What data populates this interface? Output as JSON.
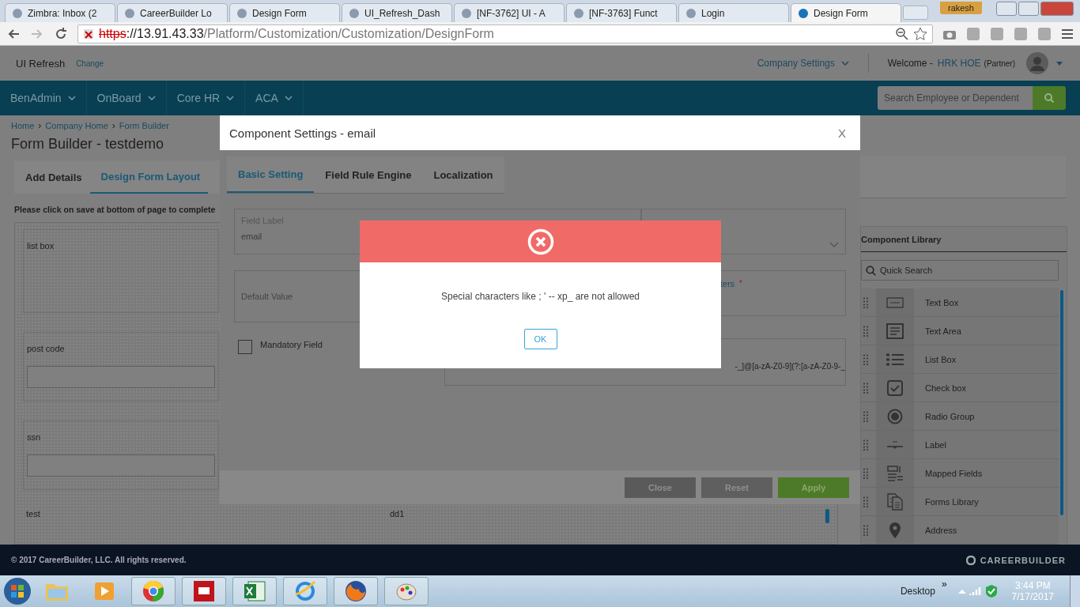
{
  "browser": {
    "tabs": [
      {
        "title": "Zimbra: Inbox (2",
        "selected": false
      },
      {
        "title": "CareerBuilder Lo",
        "selected": false
      },
      {
        "title": "Design Form",
        "selected": false
      },
      {
        "title": "UI_Refresh_Dash",
        "selected": false
      },
      {
        "title": "[NF-3762] UI - A",
        "selected": false
      },
      {
        "title": "[NF-3763] Funct",
        "selected": false
      },
      {
        "title": "Login",
        "selected": false
      },
      {
        "title": "Design Form",
        "selected": true
      }
    ],
    "user": "rakesh",
    "address": {
      "scheme": "https",
      "host": "://13.91.43.33",
      "path": "/Platform/Customization/Customization/DesignForm"
    }
  },
  "header": {
    "app": "UI Refresh",
    "change": "Change",
    "company_settings": "Company Settings",
    "welcome": "Welcome -",
    "user": "HRK HOE",
    "role": "(Partner)"
  },
  "nav": {
    "items": [
      "BenAdmin",
      "OnBoard",
      "Core HR",
      "ACA"
    ],
    "search": {
      "placeholder": "Search Employee or Dependent"
    }
  },
  "breadcrumb": [
    {
      "label": "Home"
    },
    {
      "separator": "›",
      "label": "Company Home"
    },
    {
      "separator": "›",
      "label": "Form Builder"
    }
  ],
  "title": "Form Builder - testdemo",
  "builder_tabs": [
    {
      "label": "Add Details",
      "selected": false
    },
    {
      "label": "Design Form Layout",
      "selected": true
    }
  ],
  "instruction": "Please click on save at bottom of page to complete",
  "canvas": {
    "fields": [
      {
        "label": "list box",
        "kind": "list"
      },
      {
        "label": "post code",
        "kind": "input"
      },
      {
        "label": "ssn",
        "kind": "input"
      }
    ],
    "bottom": [
      "test",
      "dd1"
    ]
  },
  "library": {
    "title": "Component Library",
    "search": {
      "placeholder": "Quick Search"
    },
    "items": [
      {
        "label": "Text Box",
        "kind": "textbox"
      },
      {
        "label": "Text Area",
        "kind": "textarea"
      },
      {
        "label": "List Box",
        "kind": "listbox"
      },
      {
        "label": "Check box",
        "kind": "checkbox"
      },
      {
        "label": "Radio Group",
        "kind": "radio"
      },
      {
        "label": "Label",
        "kind": "label"
      },
      {
        "label": "Mapped Fields",
        "kind": "mapped"
      },
      {
        "label": "Forms Library",
        "kind": "forms"
      },
      {
        "label": "Address",
        "kind": "address"
      }
    ]
  },
  "modal": {
    "title": "Component Settings - email",
    "close": "X",
    "tabs": [
      {
        "label": "Basic Setting",
        "selected": true
      },
      {
        "label": "Field Rule Engine",
        "selected": false
      },
      {
        "label": "Localization",
        "selected": false
      }
    ],
    "field_label": {
      "label": "Field Label",
      "value": "email"
    },
    "default_value": {
      "label": "Default Value"
    },
    "allowed_label": "ters",
    "required_mark": "*",
    "mandatory": {
      "label": "Mandatory Field",
      "checked": false
    },
    "regex": "-_]@[a-zA-Z0-9](?:[a-zA-Z0-9-_",
    "buttons": [
      "Close",
      "Reset",
      "Apply"
    ]
  },
  "alert": {
    "message": "Special characters like ; ' -- xp_ are not allowed",
    "button": "OK"
  },
  "footer": {
    "copyright": "© 2017 CareerBuilder, LLC. All rights reserved.",
    "brand": "CAREERBUILDER"
  },
  "taskbar": {
    "desktop": "Desktop",
    "more": "»",
    "time": "3:44 PM",
    "date": "7/17/2017"
  }
}
